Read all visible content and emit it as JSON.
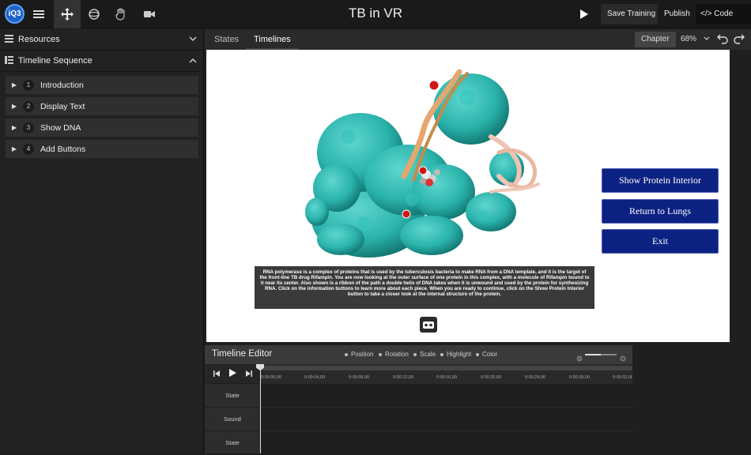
{
  "app": {
    "logo_text": "iQ3",
    "title": "TB in VR"
  },
  "toolbar": {
    "tools": [
      {
        "name": "menu-icon"
      },
      {
        "name": "move-icon",
        "active": true
      },
      {
        "name": "rotate-icon"
      },
      {
        "name": "hand-icon"
      },
      {
        "name": "camera-icon"
      }
    ],
    "save_training": "Save Training",
    "publish": "Publish",
    "code_editor": "Code Editor"
  },
  "sidebar": {
    "resources_label": "Resources",
    "timeline_sequence_label": "Timeline Sequence",
    "items": [
      {
        "num": "1",
        "label": "Introduction"
      },
      {
        "num": "2",
        "label": "Display Text"
      },
      {
        "num": "3",
        "label": "Show DNA"
      },
      {
        "num": "4",
        "label": "Add Buttons"
      }
    ]
  },
  "tabs": {
    "states": "States",
    "timelines": "Timelines",
    "chapter": "Chapter",
    "zoom": "68%"
  },
  "scene": {
    "description": "RNA polymerase is a complex of proteins that is used by the tuberculosis bacteria to make RNA from a DNA template, and it is the target of the front-line TB drug Rifampin. You are now looking at the outer surface of one protein in this complex, with a molecule of Rifampin bound to it near its center. Also shown is a ribbon of the path a double helix of DNA takes when it is unwound and used by the protein for synthesizing RNA. Click on the information buttons to learn more about each piece. When you are ready to continue, click on the Show Protein Interior button to take a closer look at the internal structure of the protein.",
    "buttons": [
      "Show Protein Interior",
      "Return to Lungs",
      "Exit"
    ],
    "colors": {
      "protein": "#2ab3ac",
      "dna": "#e0a77c",
      "button": "#0c2282"
    }
  },
  "timeline_editor": {
    "title": "Timeline Editor",
    "filters": [
      "Position",
      "Rotation",
      "Scale",
      "Highlight",
      "Color"
    ],
    "ruler": [
      "0:00:00,00",
      "0:00:04,00",
      "0:00:08,00",
      "0:00:12,00",
      "0:00:16,00",
      "0:00:20,00",
      "0:00:24,00",
      "0:00:28,00",
      "0:00:32,00"
    ],
    "tracks": [
      "State",
      "Sound",
      "State"
    ]
  }
}
